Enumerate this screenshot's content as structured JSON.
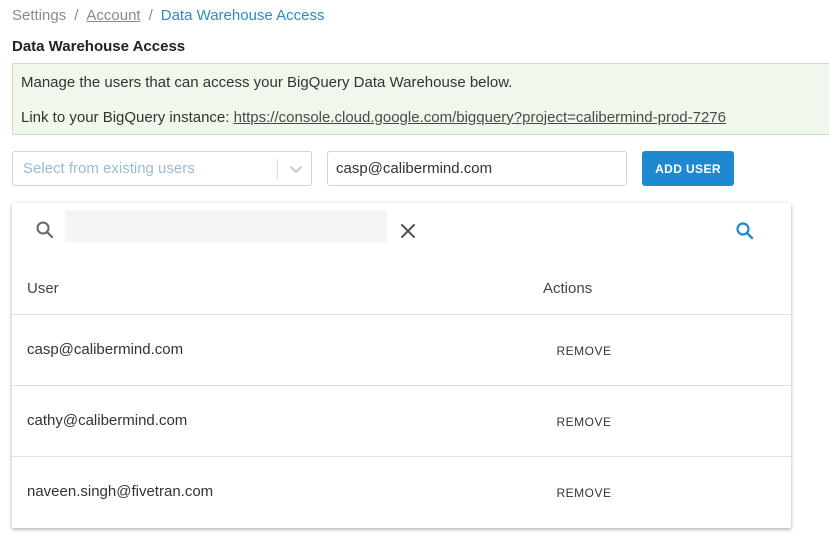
{
  "breadcrumb": {
    "items": [
      {
        "label": "Settings"
      },
      {
        "label": "Account"
      },
      {
        "label": "Data Warehouse Access"
      }
    ],
    "separator": "/"
  },
  "page": {
    "title": "Data Warehouse Access"
  },
  "info": {
    "line1": "Manage the users that can access your BigQuery Data Warehouse below.",
    "line2_prefix": "Link to your BigQuery instance: ",
    "link_text": "https://console.cloud.google.com/bigquery?project=calibermind-prod-7276"
  },
  "form": {
    "select_placeholder": "Select from existing users",
    "email_value": "casp@calibermind.com",
    "add_button_label": "ADD USER"
  },
  "table": {
    "search_value": "",
    "columns": [
      "User",
      "Actions"
    ],
    "rows": [
      {
        "user": "casp@calibermind.com",
        "action": "REMOVE"
      },
      {
        "user": "cathy@calibermind.com",
        "action": "REMOVE"
      },
      {
        "user": "naveen.singh@fivetran.com",
        "action": "REMOVE"
      }
    ]
  },
  "colors": {
    "accent": "#1e88d0",
    "breadcrumb_current": "#2b8bc6",
    "info_bg": "#eff8ea",
    "info_border": "#c9e2bc"
  },
  "icons": {
    "select_chevron": "chevron-down-icon",
    "search_left": "search-icon",
    "clear": "close-icon",
    "search_right": "search-icon"
  }
}
